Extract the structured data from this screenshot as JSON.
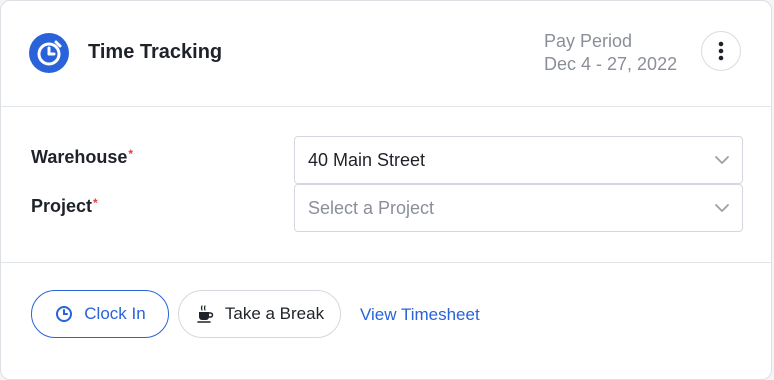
{
  "header": {
    "title": "Time Tracking",
    "pay_period_label": "Pay Period",
    "pay_period_dates": "Dec 4 - 27, 2022"
  },
  "form": {
    "warehouse": {
      "label": "Warehouse",
      "required_mark": "*",
      "value": "40 Main Street"
    },
    "project": {
      "label": "Project",
      "required_mark": "*",
      "placeholder": "Select a Project"
    }
  },
  "actions": {
    "clock_in": "Clock In",
    "take_break": "Take a Break",
    "view_timesheet": "View Timesheet"
  },
  "colors": {
    "accent": "#2962d9",
    "required": "#e0443b",
    "muted_text": "#8a8f98"
  },
  "icons": {
    "logo": "timer-logo-icon",
    "menu": "more-vertical-icon",
    "chevron": "chevron-down-icon",
    "clock": "clock-icon",
    "break": "coffee-cup-icon"
  }
}
